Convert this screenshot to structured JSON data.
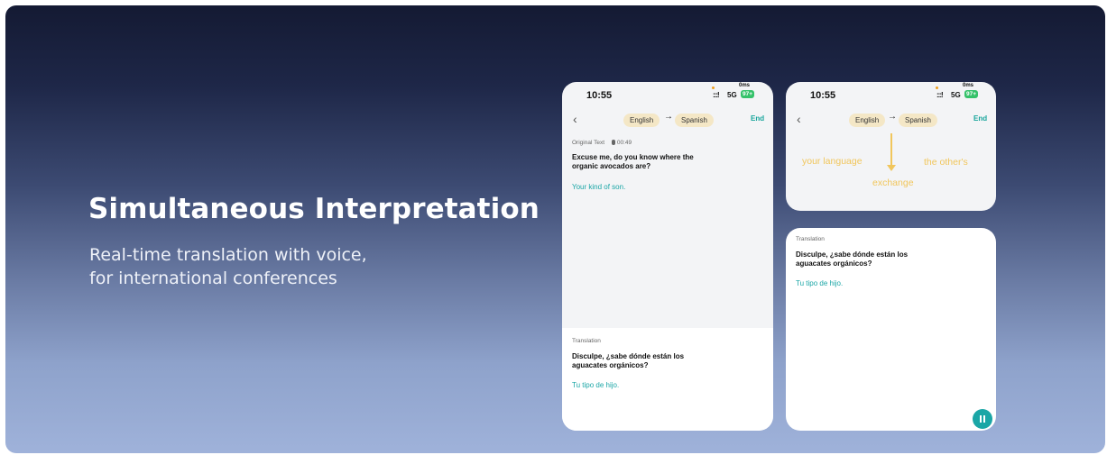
{
  "hero": {
    "title": "Simultaneous Interpretation",
    "subtitle_line1": "Real-time translation with voice,",
    "subtitle_line2": "for international conferences"
  },
  "status_bar": {
    "time": "10:55",
    "latency": "0ms",
    "signal": ":::!",
    "network": "5G",
    "battery": "97+"
  },
  "nav": {
    "back_icon": "chevron-left-icon",
    "source_language": "English",
    "arrow": "→",
    "target_language": "Spanish",
    "end_label": "End"
  },
  "original": {
    "label": "Original Text",
    "duration": "00:49",
    "text": "Excuse me, do you know where the organic avocados are?",
    "reply": "Your kind of son."
  },
  "translation": {
    "label": "Translation",
    "text": "Disculpe, ¿sabe dónde están los aguacates orgánicos?",
    "reply": "Tu tipo de hijo."
  },
  "diagram": {
    "left": "your language",
    "right": "the other's",
    "bottom": "exchange"
  },
  "colors": {
    "accent_teal": "#1aa6a6",
    "pill_bg": "#f4e7c6",
    "diagram_yellow": "#f1c65c",
    "battery_green": "#35c26a"
  }
}
